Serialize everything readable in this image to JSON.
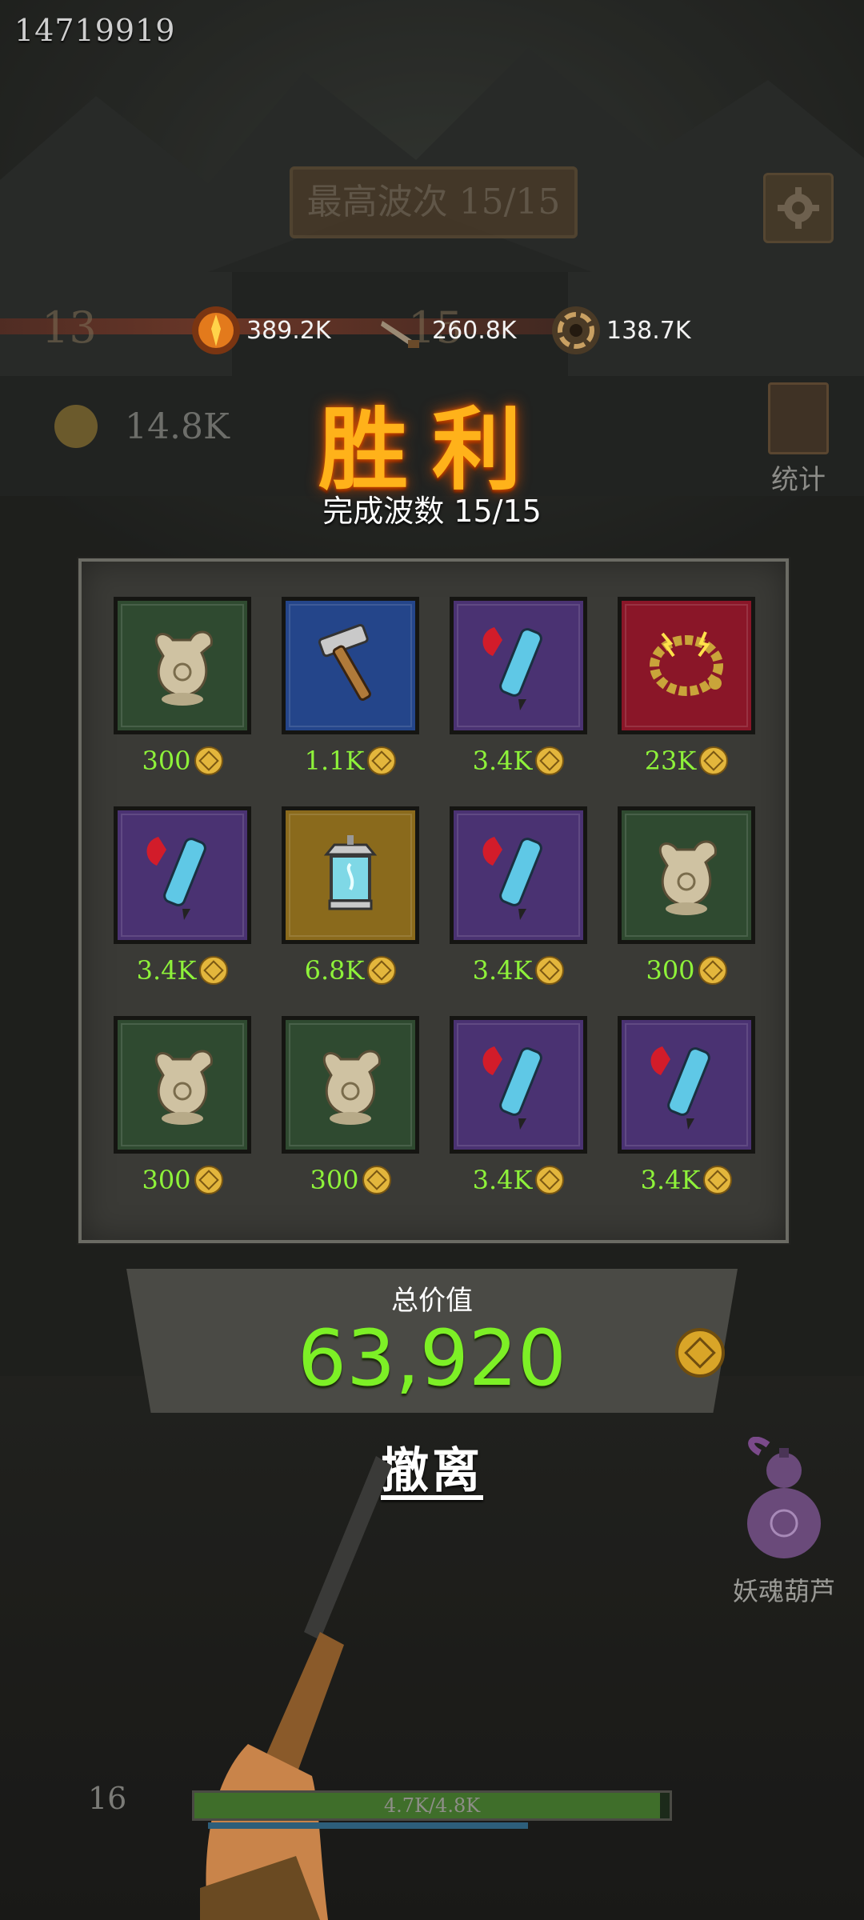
{
  "hud": {
    "player_id": "14719919",
    "best_wave_label": "最高波次 15/15",
    "level_nodes": [
      "13",
      "15"
    ],
    "stats": [
      {
        "icon": "fire-orb-icon",
        "value": "389.2K"
      },
      {
        "icon": "rifle-icon",
        "value": "260.8K"
      },
      {
        "icon": "vortex-icon",
        "value": "138.7K"
      }
    ],
    "gold_total": "14.8K",
    "stats_link": "统计"
  },
  "result": {
    "title": "胜利",
    "waves_completed": "完成波数 15/15"
  },
  "loot": [
    {
      "item": "bronze-ewer-icon",
      "rarity": "green",
      "price": "300"
    },
    {
      "item": "hammer-icon",
      "rarity": "blue",
      "price": "1.1K"
    },
    {
      "item": "tassel-brush-icon",
      "rarity": "purple",
      "price": "3.4K"
    },
    {
      "item": "coin-bracelet-icon",
      "rarity": "red",
      "price": "23K"
    },
    {
      "item": "tassel-brush-icon",
      "rarity": "purple",
      "price": "3.4K"
    },
    {
      "item": "lantern-icon",
      "rarity": "gold",
      "price": "6.8K"
    },
    {
      "item": "tassel-brush-icon",
      "rarity": "purple",
      "price": "3.4K"
    },
    {
      "item": "bronze-ewer-icon",
      "rarity": "green",
      "price": "300"
    },
    {
      "item": "bronze-ewer-icon",
      "rarity": "green",
      "price": "300"
    },
    {
      "item": "bronze-ewer-icon",
      "rarity": "green",
      "price": "300"
    },
    {
      "item": "tassel-brush-icon",
      "rarity": "purple",
      "price": "3.4K"
    },
    {
      "item": "tassel-brush-icon",
      "rarity": "purple",
      "price": "3.4K"
    }
  ],
  "total": {
    "label": "总价值",
    "value": "63,920"
  },
  "actions": {
    "evacuate": "撤离",
    "gourd": "妖魂葫芦"
  },
  "footer": {
    "level": "16",
    "xp_text": "4.7K/4.8K",
    "xp_fraction": 0.979
  },
  "colors": {
    "price": "#8ef23a",
    "victory": "#ffb21a",
    "total": "#7df026"
  }
}
